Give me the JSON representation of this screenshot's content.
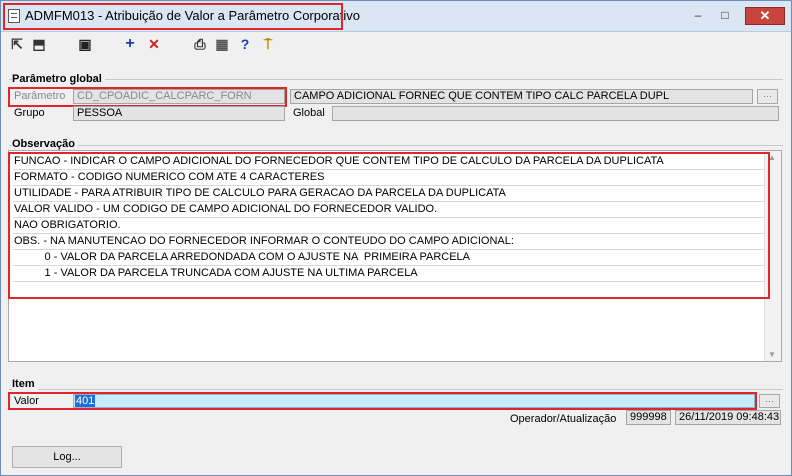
{
  "window": {
    "title": "ADMFM013 - Atribuição de Valor a Parâmetro Corporativo",
    "minimize": "–",
    "maximize": "□",
    "close": "✕"
  },
  "toolbar": {
    "nav_prev": "⇱",
    "nav_next": "⬒",
    "save": "▣",
    "add": "+",
    "delete": "✕",
    "print": "⎙",
    "calc": "▦",
    "help": "?",
    "exit": "⍑"
  },
  "parametro_global": {
    "group_title": "Parâmetro global",
    "parametro_label": "Parâmetro",
    "parametro_value": "CD_CPOADIC_CALCPARC_FORN",
    "descricao_value": "CAMPO ADICIONAL FORNEC QUE CONTEM TIPO CALC PARCELA DUPL",
    "grupo_label": "Grupo",
    "grupo_value": "PESSOA",
    "global_label": "Global",
    "global_value": ""
  },
  "observacao": {
    "group_title": "Observação",
    "lines": [
      "FUNCAO - INDICAR O CAMPO ADICIONAL DO FORNECEDOR QUE CONTEM TIPO DE CALCULO DA PARCELA DA DUPLICATA",
      "FORMATO - CODIGO NUMERICO COM ATE 4 CARACTERES",
      "UTILIDADE - PARA ATRIBUIR TIPO DE CALCULO PARA GERACAO DA PARCELA DA DUPLICATA",
      "VALOR VALIDO - UM CODIGO DE CAMPO ADICIONAL DO FORNECEDOR VALIDO.",
      "NAO OBRIGATORIO.",
      "OBS. - NA MANUTENCAO DO FORNECEDOR INFORMAR O CONTEUDO DO CAMPO ADICIONAL:",
      "          0 - VALOR DA PARCELA ARREDONDADA COM O AJUSTE NA  PRIMEIRA PARCELA",
      "          1 - VALOR DA PARCELA TRUNCADA COM AJUSTE NA ULTIMA PARCELA"
    ]
  },
  "item": {
    "group_title": "Item",
    "valor_label": "Valor",
    "valor_value": "401",
    "operador_label": "Operador/Atualização",
    "operador_value": "999998",
    "atualizacao_value": "26/11/2019 09:48:43"
  },
  "log_button": "Log...",
  "colors": {
    "highlight_border": "#e0262b",
    "valor_bg": "#c8ecfb",
    "selection": "#1e6fd9"
  }
}
